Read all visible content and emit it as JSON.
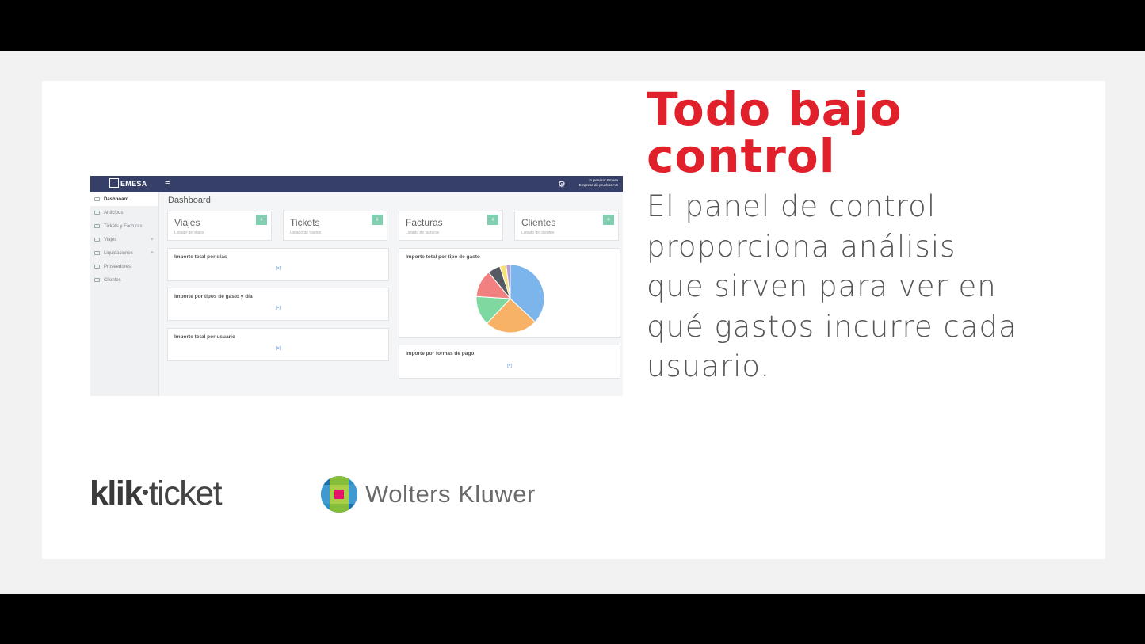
{
  "slide": {
    "headline": "Todo bajo\ncontrol",
    "body": "El panel de control\nproporciona  análisis\nque sirven para ver en\nqué  gastos incurre cada\nusuario.",
    "headline_color": "#e0202a",
    "body_color": "#555555"
  },
  "dashboard": {
    "logo_text": "EMESA",
    "user_name": "Supervisor Emesa",
    "user_company": "Empresa de pruebas AG",
    "page_title": "Dashboard",
    "sidebar": [
      {
        "label": "Dashboard",
        "icon": "monitor-icon",
        "active": true
      },
      {
        "label": "Anticipos",
        "icon": "card-icon"
      },
      {
        "label": "Tickets y Facturas",
        "icon": "document-icon"
      },
      {
        "label": "Viajes",
        "icon": "users-icon",
        "expandable": true
      },
      {
        "label": "Liquidaciones",
        "icon": "table-icon",
        "expandable": true
      },
      {
        "label": "Proveedores",
        "icon": "user-icon"
      },
      {
        "label": "Clientes",
        "icon": "user-icon"
      }
    ],
    "stats": [
      {
        "name": "Viajes",
        "sub": "Listado de viajes"
      },
      {
        "name": "Tickets",
        "sub": "Listado de gastos"
      },
      {
        "name": "Facturas",
        "sub": "Listado de facturas"
      },
      {
        "name": "Clientes",
        "sub": "Listado de clientes"
      }
    ],
    "panels": {
      "importe_dias": "Importe total por días",
      "importe_tipos_dia": "Importe por tipos de gasto y día",
      "importe_usuario": "Importe total por usuario",
      "importe_tipo_gasto": "Importe total por tipo de gasto",
      "importe_formas_pago": "Importe por formas de pago",
      "loading_glyph": "[=]"
    },
    "add_glyph": "+",
    "accent": "#353f68",
    "add_color": "#7fcfb0"
  },
  "chart_data": {
    "type": "pie",
    "title": "Importe total por tipo de gasto",
    "values": [
      37,
      25,
      14,
      13,
      6,
      3,
      2
    ],
    "colors": [
      "#7cb5ec",
      "#f7b266",
      "#7ed9a0",
      "#f28080",
      "#555a63",
      "#f6e07a",
      "#b39ddb"
    ]
  },
  "logos": {
    "klik_bold": "klik",
    "klik_light": "ticket",
    "wolters": "Wolters Kluwer"
  }
}
